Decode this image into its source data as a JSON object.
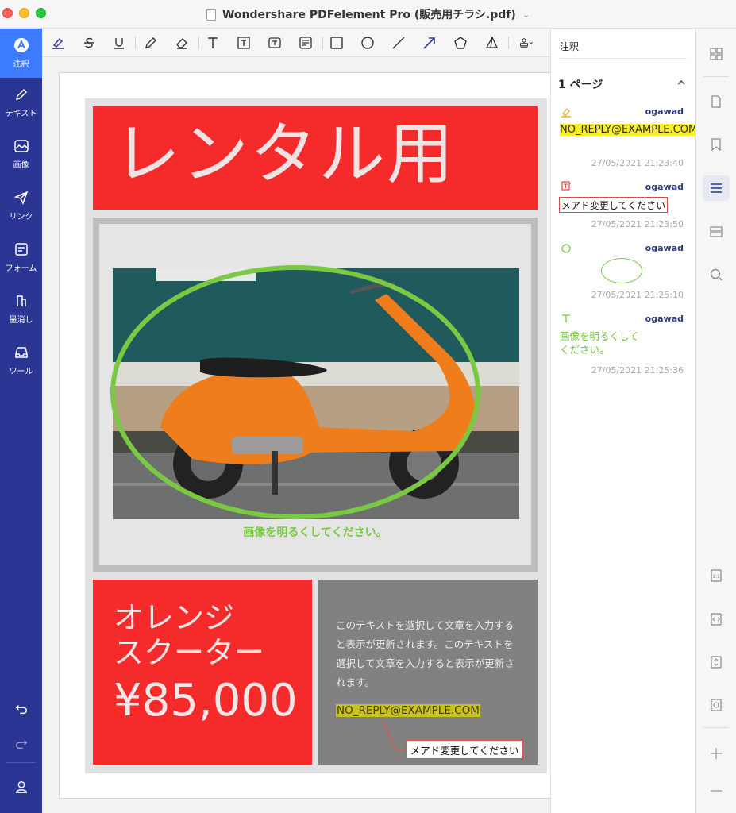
{
  "window": {
    "title": "Wondershare PDFelement Pro (販売用チラシ.pdf)"
  },
  "leftnav": {
    "items": [
      {
        "label": "注釈",
        "icon": "annotate-icon",
        "active": true
      },
      {
        "label": "テキスト",
        "icon": "pencil-icon",
        "active": false
      },
      {
        "label": "画像",
        "icon": "image-icon",
        "active": false
      },
      {
        "label": "リンク",
        "icon": "link-icon",
        "active": false
      },
      {
        "label": "フォーム",
        "icon": "form-icon",
        "active": false
      },
      {
        "label": "墨消し",
        "icon": "redact-icon",
        "active": false
      },
      {
        "label": "ツール",
        "icon": "tool-icon",
        "active": false
      }
    ]
  },
  "toolbar": {
    "tools": [
      "highlight-icon",
      "strikethrough-icon",
      "underline-icon",
      "pencil-icon",
      "eraser-icon",
      "text-icon",
      "textbox-icon",
      "callout-icon",
      "note-icon",
      "rectangle-icon",
      "ellipse-icon",
      "line-icon",
      "arrow-icon",
      "polygon-icon",
      "area-icon",
      "stamp-icon"
    ]
  },
  "document": {
    "header": "レンタル用",
    "photo_caption": "画像を明るくしてください。",
    "product_name_line1": "オレンジ",
    "product_name_line2": "スクーター",
    "price": "¥85,000",
    "body_text": "このテキストを選択して文章を入力すると表示が更新されます。このテキストを選択して文章を入力すると表示が更新されます。",
    "email": "NO_REPLY@EXAMPLE.COM",
    "callout": "メアド変更してください"
  },
  "panel": {
    "title": "注釈",
    "page_label": "1 ページ",
    "annotations": [
      {
        "type": "highlight",
        "user": "ogawad",
        "content": "NO_REPLY@EXAMPLE.COM",
        "time": "27/05/2021 21:23:40"
      },
      {
        "type": "callout",
        "user": "ogawad",
        "content": "メアド変更してください",
        "time": "27/05/2021 21:23:50"
      },
      {
        "type": "ellipse",
        "user": "ogawad",
        "time": "27/05/2021 21:25:10"
      },
      {
        "type": "text",
        "user": "ogawad",
        "content": "画像を明るくしてください。",
        "time": "27/05/2021 21:25:36"
      }
    ]
  },
  "colors": {
    "nav_bg": "#2b3594",
    "nav_active": "#3d7bff",
    "flyer_red": "#f42b2a",
    "annotation_green": "#7ac943",
    "highlight_yellow": "#f8ed2e"
  }
}
